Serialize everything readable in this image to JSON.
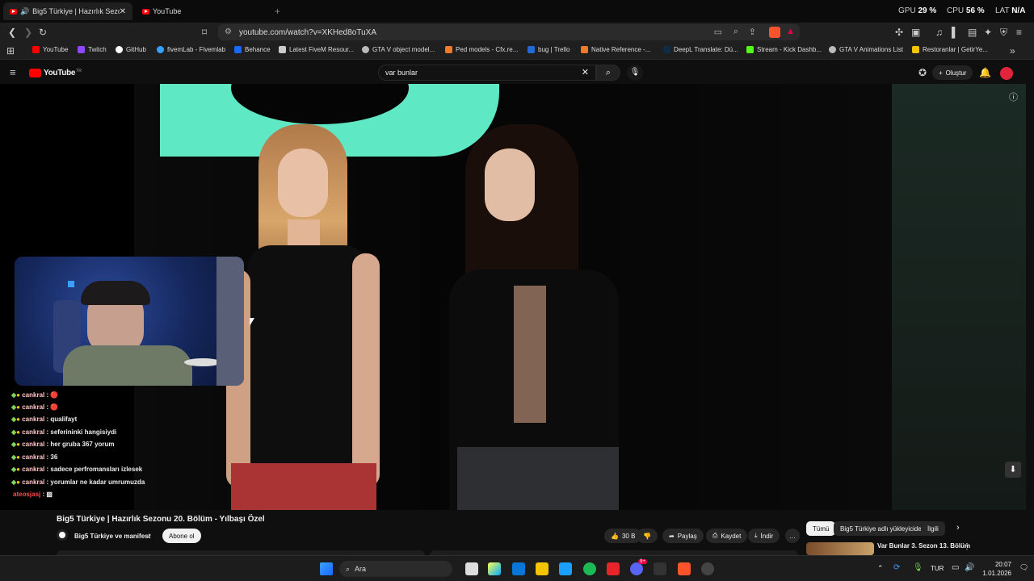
{
  "browser": {
    "tabs": [
      {
        "label": "Big5 Türkiye | Hazırlık Sezonu",
        "active": true
      },
      {
        "label": "YouTube",
        "active": false
      }
    ],
    "new_tab_symbol": "+",
    "stats": {
      "gpu_label": "GPU",
      "gpu_value": "29 %",
      "cpu_label": "CPU",
      "cpu_value": "56 %",
      "lat_label": "LAT",
      "lat_value": "N/A"
    },
    "url": "youtube.com/watch?v=XKHed8oTuXA"
  },
  "bookmarks": [
    {
      "label": "YouTube",
      "color": "#ff0000"
    },
    {
      "label": "Twitch",
      "color": "#9146ff"
    },
    {
      "label": "GitHub",
      "color": "#ffffff"
    },
    {
      "label": "fivemLab - Fivemlab",
      "color": "#3aa0ff"
    },
    {
      "label": "Behance",
      "color": "#1769ff"
    },
    {
      "label": "Latest FiveM Resour...",
      "color": "#cccccc"
    },
    {
      "label": "GTA V object model...",
      "color": "#bbbbbb"
    },
    {
      "label": "Ped models - Cfx.re...",
      "color": "#f07a2a"
    },
    {
      "label": "bug | Trello",
      "color": "#1e6bd6"
    },
    {
      "label": "Native Reference -...",
      "color": "#f07a2a"
    },
    {
      "label": "DeepL Translate: Dü...",
      "color": "#0f2b46"
    },
    {
      "label": "Stream - Kick Dashb...",
      "color": "#53fc18"
    },
    {
      "label": "GTA V Animations List",
      "color": "#bbbbbb"
    },
    {
      "label": "Restoranlar | GetirYe...",
      "color": "#f5c400"
    }
  ],
  "youtube": {
    "logo": "YouTube",
    "logo_sup": "TR",
    "search_value": "var bunlar",
    "create_label": "Oluştur"
  },
  "chat": [
    {
      "user": "cankral",
      "text": "🔴"
    },
    {
      "user": "cankral",
      "text": "🔴"
    },
    {
      "user": "cankral",
      "text": "qualifayt"
    },
    {
      "user": "cankral",
      "text": "seferininki hangisiydi"
    },
    {
      "user": "cankral",
      "text": "her gruba 367 yorum"
    },
    {
      "user": "cankral",
      "text": "36"
    },
    {
      "user": "cankral",
      "text": "sadece perfromansları izlesek"
    },
    {
      "user": "cankral",
      "text": "yorumlar ne kadar umrumuzda"
    },
    {
      "user": "ateosjasj",
      "text": "▨"
    }
  ],
  "video": {
    "title": "Big5 Türkiye | Hazırlık Sezonu 20. Bölüm - Yılbaşı Özel",
    "channel": "Big5 Türkiye ve manifest",
    "subscribe": "Abone ol",
    "likes": "30 B",
    "share": "Paylaş",
    "save": "Kaydet",
    "download": "İndir",
    "more": "…"
  },
  "filters": [
    "Tümü",
    "Big5 Türkiye adlı yükleyiciden",
    "İlgili"
  ],
  "related_title": "Var Bunlar 3. Sezon 13. Bölüm",
  "taskbar": {
    "search_label": "Ara",
    "lang": "TUR",
    "time": "20:07",
    "date": "1.01.2026",
    "notif_count": "9+"
  },
  "colors": {
    "accent": "#ff0000",
    "bg": "#0f0f0f",
    "green_screen": "#5fe8c4"
  }
}
